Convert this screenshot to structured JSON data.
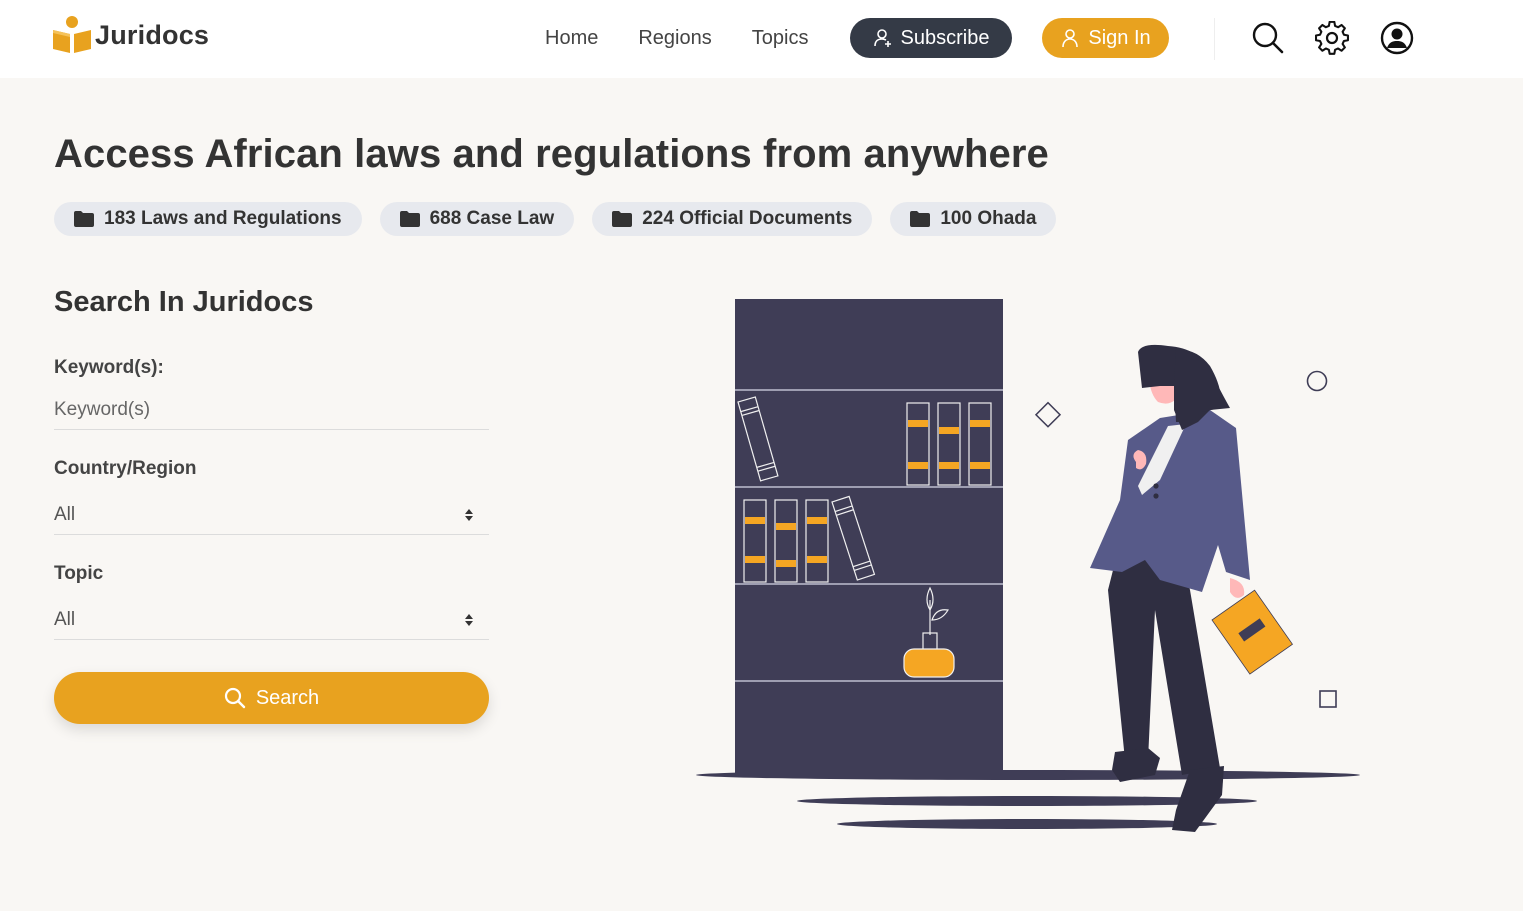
{
  "brand": {
    "name": "Juridocs"
  },
  "nav": {
    "items": [
      {
        "label": "Home"
      },
      {
        "label": "Regions"
      },
      {
        "label": "Topics"
      }
    ],
    "subscribe_label": "Subscribe",
    "signin_label": "Sign In"
  },
  "header_icons": [
    "search-icon",
    "gear-icon",
    "user-circle-icon"
  ],
  "hero": {
    "title": "Access African laws and regulations from anywhere",
    "badges": [
      {
        "label": "183 Laws and Regulations"
      },
      {
        "label": "688 Case Law"
      },
      {
        "label": "224 Official Documents"
      },
      {
        "label": "100 Ohada"
      }
    ]
  },
  "search": {
    "title": "Search In Juridocs",
    "keyword_label": "Keyword(s):",
    "keyword_placeholder": "Keyword(s)",
    "keyword_value": "",
    "country_label": "Country/Region",
    "country_value": "All",
    "topic_label": "Topic",
    "topic_value": "All",
    "button_label": "Search"
  },
  "colors": {
    "accent": "#e8a21f",
    "dark": "#343a46",
    "background": "#f9f7f4",
    "illustration_dark": "#3f3d56",
    "illustration_purple": "#575a89"
  }
}
